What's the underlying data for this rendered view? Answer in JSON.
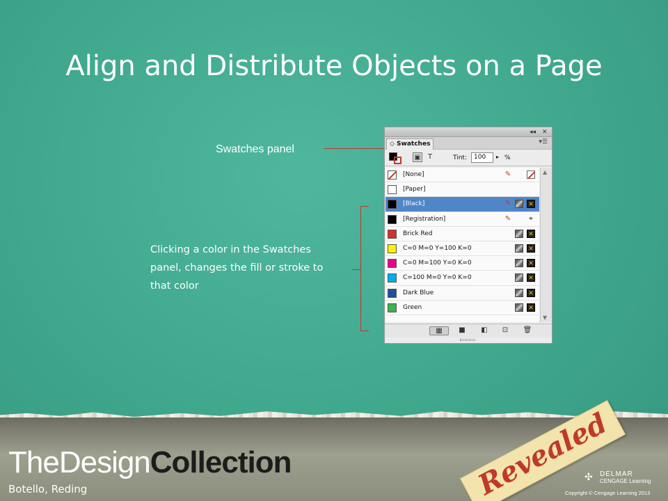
{
  "slide": {
    "title": "Align and Distribute Objects on a Page",
    "callout_label": "Swatches panel",
    "description": "Clicking a color in the Swatches panel, changes the fill or stroke to that color"
  },
  "panel": {
    "topbar_controls": [
      "◂◂",
      "✕"
    ],
    "tab_label": "◇ Swatches",
    "tab_menu": "▾☰",
    "tint_label": "Tint:",
    "tint_value": "100",
    "tint_arrow": "▸",
    "tint_unit": "%",
    "tool_icons": [
      "formatting-box-icon",
      "formatting-text-icon"
    ],
    "text_tool_glyph": "T",
    "swatches": [
      {
        "name": "[None]",
        "color": "#ffffff",
        "none": true,
        "selected": false,
        "icons": [
          "pencil-crossed",
          "none-swatch"
        ]
      },
      {
        "name": "[Paper]",
        "color": "#ffffff",
        "none": false,
        "selected": false,
        "icons": []
      },
      {
        "name": "[Black]",
        "color": "#000000",
        "none": false,
        "selected": true,
        "icons": [
          "pencil-crossed",
          "process",
          "cmyk"
        ]
      },
      {
        "name": "[Registration]",
        "color": "#000000",
        "none": false,
        "selected": false,
        "icons": [
          "pencil-crossed",
          "registration"
        ]
      },
      {
        "name": "Brick Red",
        "color": "#d0322d",
        "none": false,
        "selected": false,
        "icons": [
          "process",
          "cmyk"
        ]
      },
      {
        "name": "C=0 M=0 Y=100 K=0",
        "color": "#fff200",
        "none": false,
        "selected": false,
        "icons": [
          "process",
          "cmyk"
        ]
      },
      {
        "name": "C=0 M=100 Y=0 K=0",
        "color": "#ec008c",
        "none": false,
        "selected": false,
        "icons": [
          "process",
          "cmyk"
        ]
      },
      {
        "name": "C=100 M=0 Y=0 K=0",
        "color": "#00aeef",
        "none": false,
        "selected": false,
        "icons": [
          "process",
          "cmyk"
        ]
      },
      {
        "name": "Dark Blue",
        "color": "#1f4e9a",
        "none": false,
        "selected": false,
        "icons": [
          "process",
          "cmyk"
        ]
      },
      {
        "name": "Green",
        "color": "#39b54a",
        "none": false,
        "selected": false,
        "icons": [
          "process",
          "cmyk"
        ]
      }
    ],
    "bottom_buttons": [
      {
        "name": "show-all-swatches-button",
        "glyph": "▦"
      },
      {
        "name": "show-color-swatches-button",
        "glyph": "■"
      },
      {
        "name": "show-gradient-swatches-button",
        "glyph": "◧"
      },
      {
        "name": "new-swatch-button",
        "glyph": "⊡"
      },
      {
        "name": "delete-swatch-button",
        "glyph": "🗑"
      }
    ]
  },
  "footer": {
    "brand_light": "TheDesign",
    "brand_bold": "Collection",
    "authors": "Botello, Reding",
    "tag_text": "Revealed",
    "publisher_line1": "DELMAR",
    "publisher_line2": "CENGAGE Learning",
    "copyright": "Copyright © Cengage Learning 2013"
  },
  "colors": {
    "background": "#43ad93",
    "accent_line": "#c0392b",
    "selected_row": "#4f86c8",
    "tag": "#f3e4ad"
  }
}
